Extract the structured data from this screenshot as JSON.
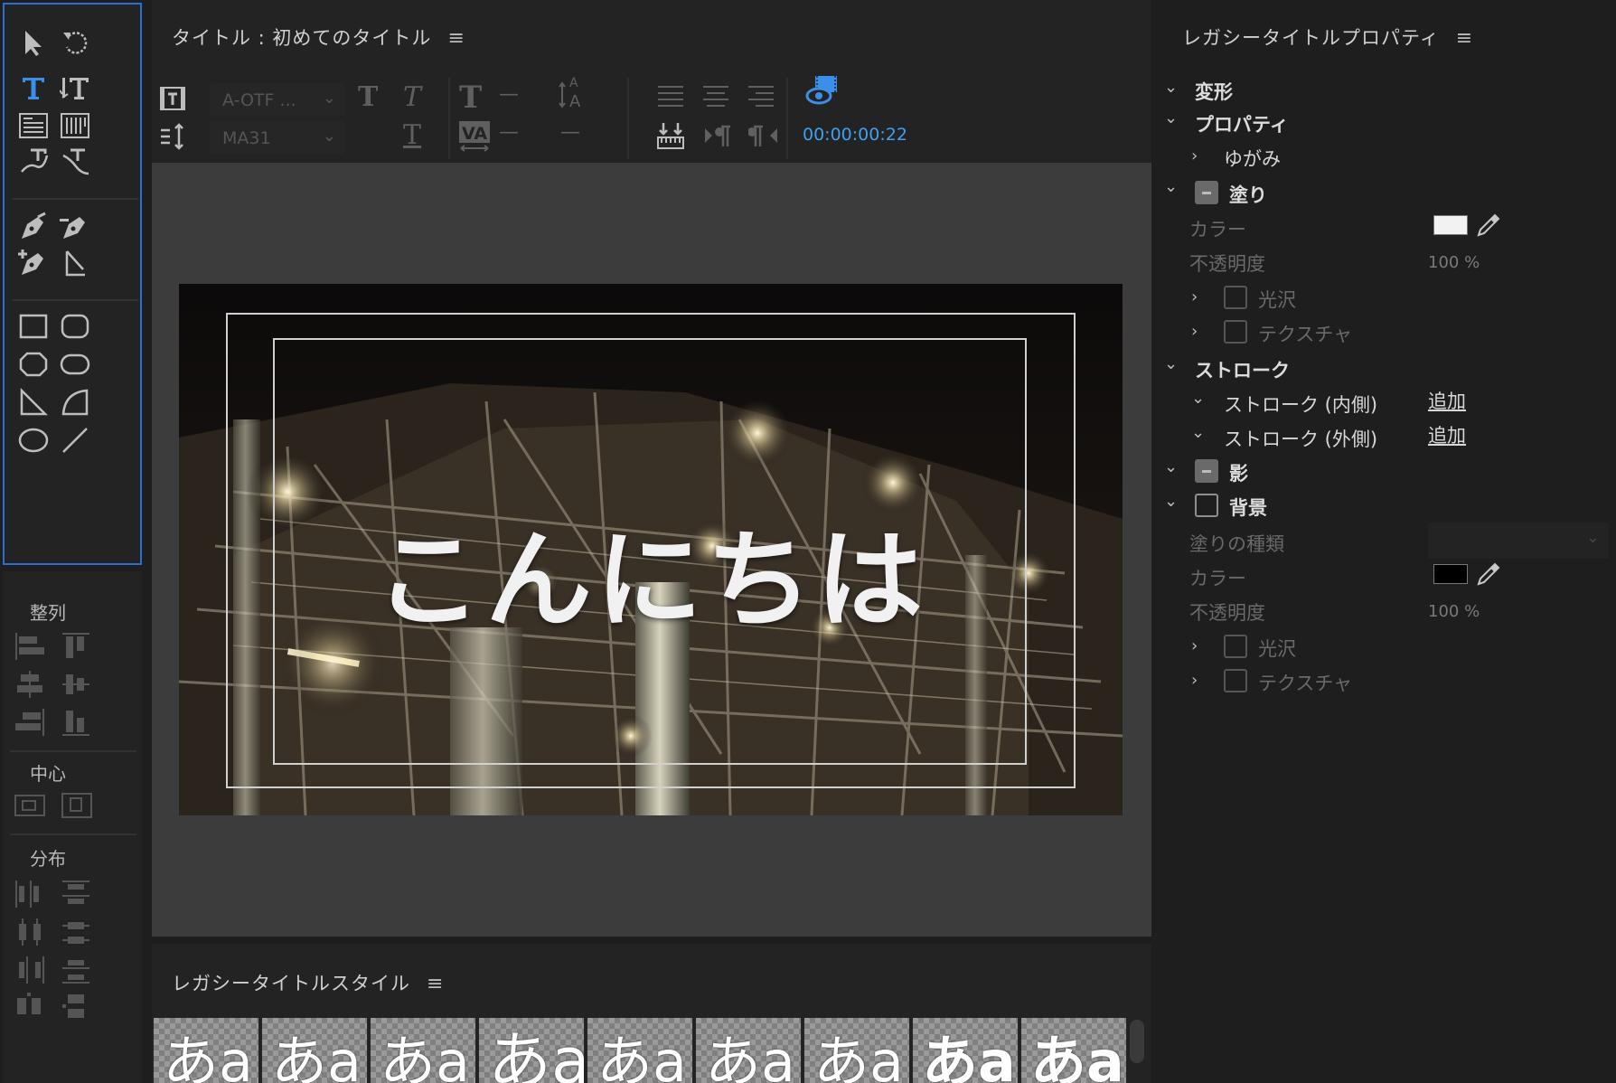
{
  "editor": {
    "tab_title": "タイトル : 初めてのタイトル",
    "menu_icon": "≡",
    "font_family": "A-OTF ...",
    "font_style": "MA31",
    "dash1": "—",
    "dash2": "—",
    "dash3": "—",
    "timecode": "00:00:00:22",
    "title_text": "こんにちは"
  },
  "align_panel": {
    "align_label": "整列",
    "center_label": "中心",
    "distribute_label": "分布"
  },
  "styles_panel": {
    "title": "レガシータイトルスタイル",
    "menu_icon": "≡",
    "swatches": [
      "あa",
      "あa",
      "あa",
      "あa",
      "あa",
      "あa",
      "あa",
      "あa",
      "あa"
    ]
  },
  "properties": {
    "title": "レガシータイトルプロパティ",
    "menu_icon": "≡",
    "transform": "変形",
    "properties": "プロパティ",
    "distort": "ゆがみ",
    "fill": "塗り",
    "fill_color": "カラー",
    "fill_opacity": "不透明度",
    "fill_opacity_value": "100 %",
    "fill_sheen": "光沢",
    "fill_texture": "テクスチャ",
    "stroke": "ストローク",
    "inner_stroke": "ストローク (内側)",
    "outer_stroke": "ストローク (外側)",
    "add1": "追加",
    "add2": "追加",
    "shadow": "影",
    "background": "背景",
    "fill_type": "塗りの種類",
    "bg_color": "カラー",
    "bg_opacity": "不透明度",
    "bg_opacity_value": "100 %",
    "bg_sheen": "光沢",
    "bg_texture": "テクスチャ",
    "fill_color_hex": "#f2f2f2",
    "bg_color_hex": "#000000"
  },
  "colors": {
    "accent": "#2d6fd0",
    "timecode": "#3fa0f0"
  }
}
